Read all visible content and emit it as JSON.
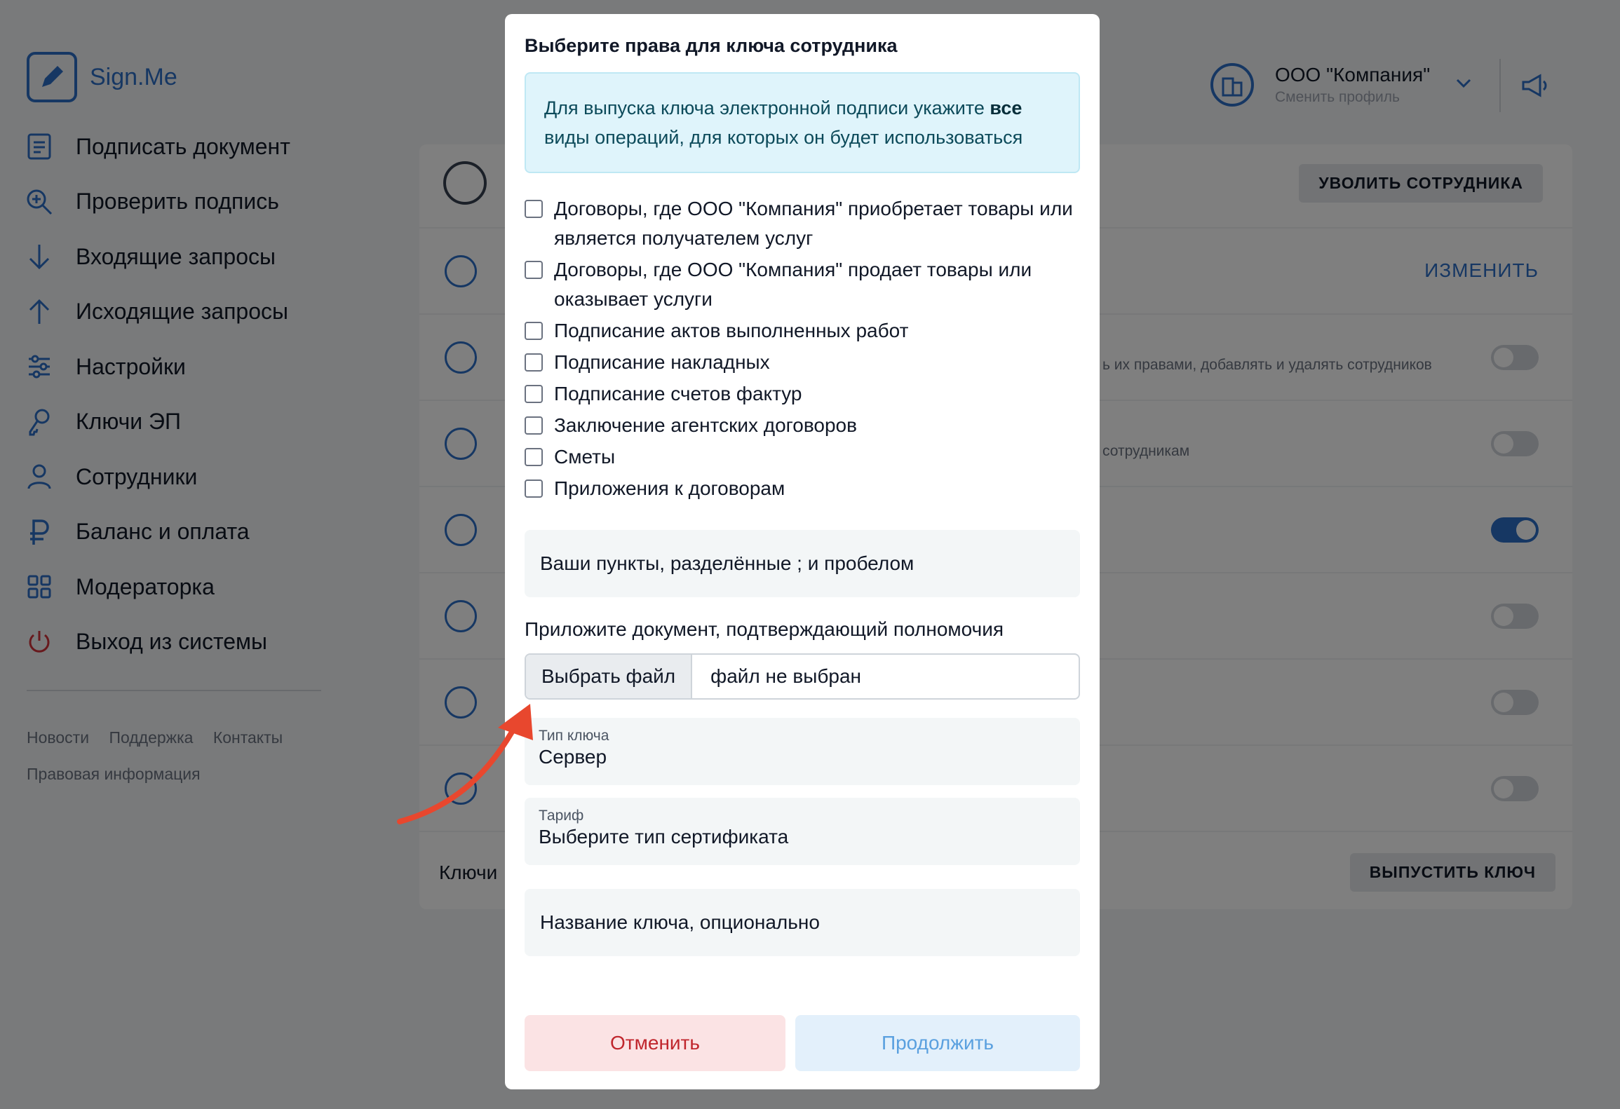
{
  "app": {
    "logo_text": "Sign.Me",
    "nav": [
      {
        "label": "Подписать документ",
        "icon": "document-sign-icon"
      },
      {
        "label": "Проверить подпись",
        "icon": "search-check-icon"
      },
      {
        "label": "Входящие запросы",
        "icon": "arrow-down-icon"
      },
      {
        "label": "Исходящие запросы",
        "icon": "arrow-up-icon"
      },
      {
        "label": "Настройки",
        "icon": "sliders-icon"
      },
      {
        "label": "Ключи ЭП",
        "icon": "key-icon"
      },
      {
        "label": "Сотрудники",
        "icon": "user-icon"
      },
      {
        "label": "Баланс и оплата",
        "icon": "ruble-icon"
      },
      {
        "label": "Модераторка",
        "icon": "grid-icon"
      },
      {
        "label": "Выход из системы",
        "icon": "power-icon"
      }
    ],
    "footer_links": [
      "Новости",
      "Поддержка",
      "Контакты"
    ],
    "footer_link_legal": "Правовая информация",
    "company_name": "ООО \"Компания\"",
    "company_switch": "Сменить профиль",
    "fire_button": "УВОЛИТЬ СОТРУДНИКА",
    "edit_action": "ИЗМЕНИТЬ",
    "perm_desc_1": "ь их правами, добавлять и удалять сотрудников",
    "perm_desc_2": "сотрудникам",
    "keys_label": "Ключи",
    "issue_button": "ВЫПУСТИТЬ КЛЮЧ",
    "colors": {
      "accent": "#2d6fc7",
      "danger": "#c0262d",
      "info_bg": "#dff4fb"
    }
  },
  "modal": {
    "title": "Выберите права для ключа сотрудника",
    "info_text_before": "Для выпуска ключа электронной подписи укажите ",
    "info_text_bold": "все",
    "info_text_after": " виды операций, для которых он будет использоваться",
    "checkboxes": [
      "Договоры, где ООО \"Компания\" приобретает товары или является получателем услуг",
      "Договоры, где ООО \"Компания\" продает товары или оказывает услуги",
      "Подписание актов выполненных работ",
      "Подписание накладных",
      "Подписание счетов фактур",
      "Заключение агентских договоров",
      "Сметы",
      "Приложения к договорам"
    ],
    "custom_items_placeholder": "Ваши пункты, разделённые ; и пробелом",
    "attach_label": "Приложите документ, подтверждающий полномочия",
    "file_button": "Выбрать файл",
    "file_status": "файл не выбран",
    "key_type_caption": "Тип ключа",
    "key_type_value": "Сервер",
    "tariff_caption": "Тариф",
    "tariff_value": "Выберите тип сертификата",
    "key_name_placeholder": "Название ключа, опционально",
    "cancel_button": "Отменить",
    "continue_button": "Продолжить"
  }
}
